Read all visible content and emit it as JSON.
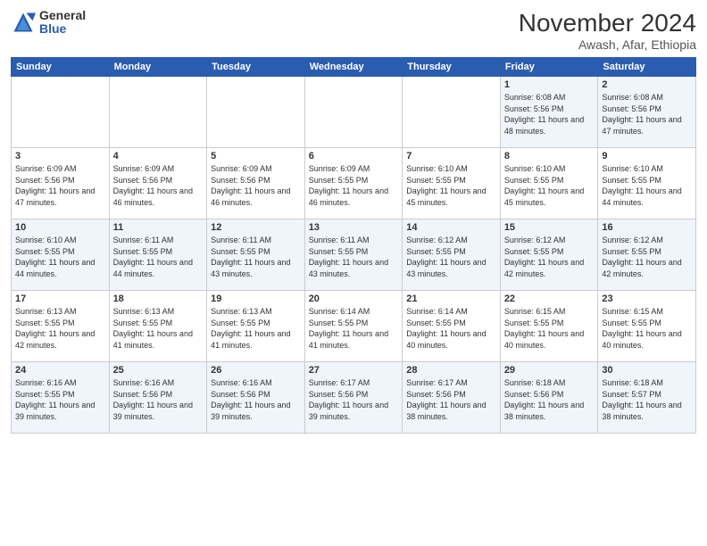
{
  "logo": {
    "general": "General",
    "blue": "Blue"
  },
  "header": {
    "title": "November 2024",
    "subtitle": "Awash, Afar, Ethiopia"
  },
  "days": [
    "Sunday",
    "Monday",
    "Tuesday",
    "Wednesday",
    "Thursday",
    "Friday",
    "Saturday"
  ],
  "weeks": [
    [
      {
        "date": "",
        "content": ""
      },
      {
        "date": "",
        "content": ""
      },
      {
        "date": "",
        "content": ""
      },
      {
        "date": "",
        "content": ""
      },
      {
        "date": "",
        "content": ""
      },
      {
        "date": "1",
        "content": "Sunrise: 6:08 AM\nSunset: 5:56 PM\nDaylight: 11 hours and 48 minutes."
      },
      {
        "date": "2",
        "content": "Sunrise: 6:08 AM\nSunset: 5:56 PM\nDaylight: 11 hours and 47 minutes."
      }
    ],
    [
      {
        "date": "3",
        "content": "Sunrise: 6:09 AM\nSunset: 5:56 PM\nDaylight: 11 hours and 47 minutes."
      },
      {
        "date": "4",
        "content": "Sunrise: 6:09 AM\nSunset: 5:56 PM\nDaylight: 11 hours and 46 minutes."
      },
      {
        "date": "5",
        "content": "Sunrise: 6:09 AM\nSunset: 5:56 PM\nDaylight: 11 hours and 46 minutes."
      },
      {
        "date": "6",
        "content": "Sunrise: 6:09 AM\nSunset: 5:55 PM\nDaylight: 11 hours and 46 minutes."
      },
      {
        "date": "7",
        "content": "Sunrise: 6:10 AM\nSunset: 5:55 PM\nDaylight: 11 hours and 45 minutes."
      },
      {
        "date": "8",
        "content": "Sunrise: 6:10 AM\nSunset: 5:55 PM\nDaylight: 11 hours and 45 minutes."
      },
      {
        "date": "9",
        "content": "Sunrise: 6:10 AM\nSunset: 5:55 PM\nDaylight: 11 hours and 44 minutes."
      }
    ],
    [
      {
        "date": "10",
        "content": "Sunrise: 6:10 AM\nSunset: 5:55 PM\nDaylight: 11 hours and 44 minutes."
      },
      {
        "date": "11",
        "content": "Sunrise: 6:11 AM\nSunset: 5:55 PM\nDaylight: 11 hours and 44 minutes."
      },
      {
        "date": "12",
        "content": "Sunrise: 6:11 AM\nSunset: 5:55 PM\nDaylight: 11 hours and 43 minutes."
      },
      {
        "date": "13",
        "content": "Sunrise: 6:11 AM\nSunset: 5:55 PM\nDaylight: 11 hours and 43 minutes."
      },
      {
        "date": "14",
        "content": "Sunrise: 6:12 AM\nSunset: 5:55 PM\nDaylight: 11 hours and 43 minutes."
      },
      {
        "date": "15",
        "content": "Sunrise: 6:12 AM\nSunset: 5:55 PM\nDaylight: 11 hours and 42 minutes."
      },
      {
        "date": "16",
        "content": "Sunrise: 6:12 AM\nSunset: 5:55 PM\nDaylight: 11 hours and 42 minutes."
      }
    ],
    [
      {
        "date": "17",
        "content": "Sunrise: 6:13 AM\nSunset: 5:55 PM\nDaylight: 11 hours and 42 minutes."
      },
      {
        "date": "18",
        "content": "Sunrise: 6:13 AM\nSunset: 5:55 PM\nDaylight: 11 hours and 41 minutes."
      },
      {
        "date": "19",
        "content": "Sunrise: 6:13 AM\nSunset: 5:55 PM\nDaylight: 11 hours and 41 minutes."
      },
      {
        "date": "20",
        "content": "Sunrise: 6:14 AM\nSunset: 5:55 PM\nDaylight: 11 hours and 41 minutes."
      },
      {
        "date": "21",
        "content": "Sunrise: 6:14 AM\nSunset: 5:55 PM\nDaylight: 11 hours and 40 minutes."
      },
      {
        "date": "22",
        "content": "Sunrise: 6:15 AM\nSunset: 5:55 PM\nDaylight: 11 hours and 40 minutes."
      },
      {
        "date": "23",
        "content": "Sunrise: 6:15 AM\nSunset: 5:55 PM\nDaylight: 11 hours and 40 minutes."
      }
    ],
    [
      {
        "date": "24",
        "content": "Sunrise: 6:16 AM\nSunset: 5:55 PM\nDaylight: 11 hours and 39 minutes."
      },
      {
        "date": "25",
        "content": "Sunrise: 6:16 AM\nSunset: 5:56 PM\nDaylight: 11 hours and 39 minutes."
      },
      {
        "date": "26",
        "content": "Sunrise: 6:16 AM\nSunset: 5:56 PM\nDaylight: 11 hours and 39 minutes."
      },
      {
        "date": "27",
        "content": "Sunrise: 6:17 AM\nSunset: 5:56 PM\nDaylight: 11 hours and 39 minutes."
      },
      {
        "date": "28",
        "content": "Sunrise: 6:17 AM\nSunset: 5:56 PM\nDaylight: 11 hours and 38 minutes."
      },
      {
        "date": "29",
        "content": "Sunrise: 6:18 AM\nSunset: 5:56 PM\nDaylight: 11 hours and 38 minutes."
      },
      {
        "date": "30",
        "content": "Sunrise: 6:18 AM\nSunset: 5:57 PM\nDaylight: 11 hours and 38 minutes."
      }
    ]
  ]
}
